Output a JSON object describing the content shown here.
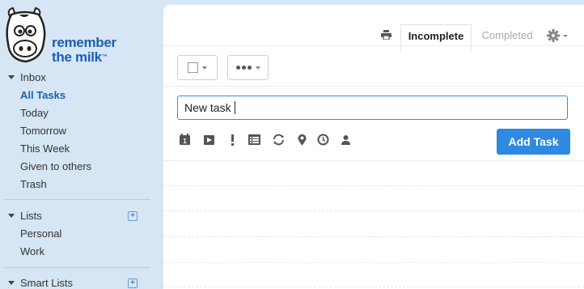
{
  "brand": {
    "line1": "remember",
    "line2": "the milk",
    "trademark": "™"
  },
  "sidebar": {
    "inbox": {
      "heading": "Inbox",
      "items": [
        {
          "label": "All Tasks",
          "active": true
        },
        {
          "label": "Today"
        },
        {
          "label": "Tomorrow"
        },
        {
          "label": "This Week"
        },
        {
          "label": "Given to others"
        },
        {
          "label": "Trash"
        }
      ]
    },
    "lists": {
      "heading": "Lists",
      "items": [
        {
          "label": "Personal"
        },
        {
          "label": "Work"
        }
      ]
    },
    "smart_lists": {
      "heading": "Smart Lists"
    }
  },
  "header": {
    "tabs": [
      {
        "label": "Incomplete",
        "selected": true
      },
      {
        "label": "Completed",
        "selected": false
      }
    ],
    "icons": [
      "print-icon",
      "gear-icon"
    ]
  },
  "task_entry": {
    "value": "New task",
    "add_label": "Add Task",
    "tool_icons": [
      "due-date-icon",
      "start-date-icon",
      "priority-icon",
      "list-icon",
      "repeat-icon",
      "location-icon",
      "estimate-icon",
      "assign-icon"
    ]
  },
  "colors": {
    "accent": "#2d8ae0",
    "brand": "#1b5fb3",
    "sidebar_bg": "#d6e6f5"
  }
}
